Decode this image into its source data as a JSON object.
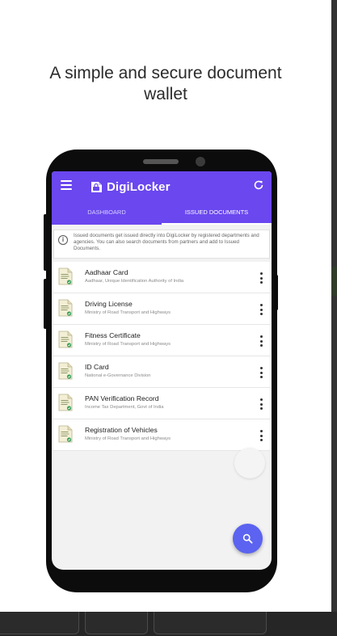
{
  "promo": {
    "headline_line1": "A simple and secure document",
    "headline_line2": "wallet"
  },
  "app": {
    "name": "DigiLocker",
    "accent_color": "#6a47ef",
    "fab_color": "#5b63f0",
    "icons": {
      "menu": "hamburger-menu-icon",
      "refresh": "refresh-icon",
      "info": "info-icon",
      "document": "document-icon",
      "more": "more-vertical-icon",
      "search": "search-icon"
    }
  },
  "tabs": [
    {
      "label": "DASHBOARD",
      "active": false
    },
    {
      "label": "ISSUED DOCUMENTS",
      "active": true
    }
  ],
  "info_banner": {
    "text": "Issued documents get issued directly into DigiLocker by registered departments and agencies. You can also search documents from partners and add to Issued Documents."
  },
  "documents": [
    {
      "title": "Aadhaar Card",
      "issuer": "Aadhaar, Unique Identification Authority of India"
    },
    {
      "title": "Driving License",
      "issuer": "Ministry of Road Transport and Highways"
    },
    {
      "title": "Fitness Certificate",
      "issuer": "Ministry of Road Transport and Highways"
    },
    {
      "title": "ID Card",
      "issuer": "National e-Governance Division"
    },
    {
      "title": "PAN Verification Record",
      "issuer": "Income Tax Department, Govt of India"
    },
    {
      "title": "Registration of Vehicles",
      "issuer": "Ministry of Road Transport and Highways"
    }
  ]
}
